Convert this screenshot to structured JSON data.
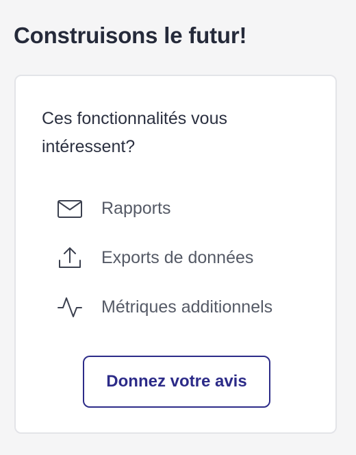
{
  "header": {
    "title": "Construisons le futur!"
  },
  "card": {
    "question": "Ces fonctionnalités vous intéressent?",
    "features": [
      {
        "label": "Rapports",
        "icon": "envelope-icon"
      },
      {
        "label": "Exports de données",
        "icon": "upload-icon"
      },
      {
        "label": "Métriques additionnels",
        "icon": "activity-icon"
      }
    ],
    "button_label": "Donnez votre avis"
  },
  "colors": {
    "background": "#f5f5f6",
    "card": "#ffffff",
    "accent": "#2c2b88",
    "text": "#252a3a"
  }
}
